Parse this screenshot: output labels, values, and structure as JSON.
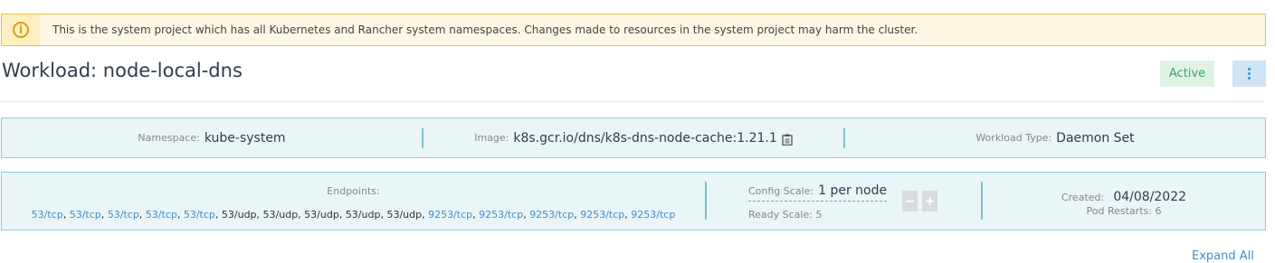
{
  "banner": {
    "icon": "info-circle-icon",
    "text": "This is the system project which has all Kubernetes and Rancher system namespaces. Changes made to resources in the system project may harm the cluster."
  },
  "header": {
    "title": "Workload: node-local-dns",
    "status": "Active",
    "menu_icon": "kebab-menu-icon"
  },
  "info": {
    "namespace_label": "Namespace:",
    "namespace_value": "kube-system",
    "image_label": "Image:",
    "image_value": "k8s.gcr.io/dns/k8s-dns-node-cache:1.21.1",
    "workload_type_label": "Workload Type:",
    "workload_type_value": "Daemon Set"
  },
  "details": {
    "endpoints_label": "Endpoints:",
    "endpoints": [
      {
        "text": "53/tcp",
        "link": true
      },
      {
        "text": "53/tcp",
        "link": true
      },
      {
        "text": "53/tcp",
        "link": true
      },
      {
        "text": "53/tcp",
        "link": true
      },
      {
        "text": "53/tcp",
        "link": true
      },
      {
        "text": "53/udp",
        "link": false
      },
      {
        "text": "53/udp",
        "link": false
      },
      {
        "text": "53/udp",
        "link": false
      },
      {
        "text": "53/udp",
        "link": false
      },
      {
        "text": "53/udp",
        "link": false
      },
      {
        "text": "9253/tcp",
        "link": true
      },
      {
        "text": "9253/tcp",
        "link": true
      },
      {
        "text": "9253/tcp",
        "link": true
      },
      {
        "text": "9253/tcp",
        "link": true
      },
      {
        "text": "9253/tcp",
        "link": true
      }
    ],
    "config_scale_label": "Config Scale:",
    "config_scale_value": "1 per node",
    "ready_scale_label": "Ready Scale:",
    "ready_scale_value": "5",
    "decrement_label": "−",
    "increment_label": "+",
    "created_label": "Created:",
    "created_value": "04/08/2022",
    "pod_restarts_label": "Pod Restarts:",
    "pod_restarts_value": "6"
  },
  "footer": {
    "expand_all": "Expand All"
  },
  "colors": {
    "accent": "#3d8fd1",
    "active_text": "#3aa862",
    "warning": "#d4a017",
    "panel_bg": "#e9f5f6",
    "panel_border": "#8fcfcf"
  }
}
